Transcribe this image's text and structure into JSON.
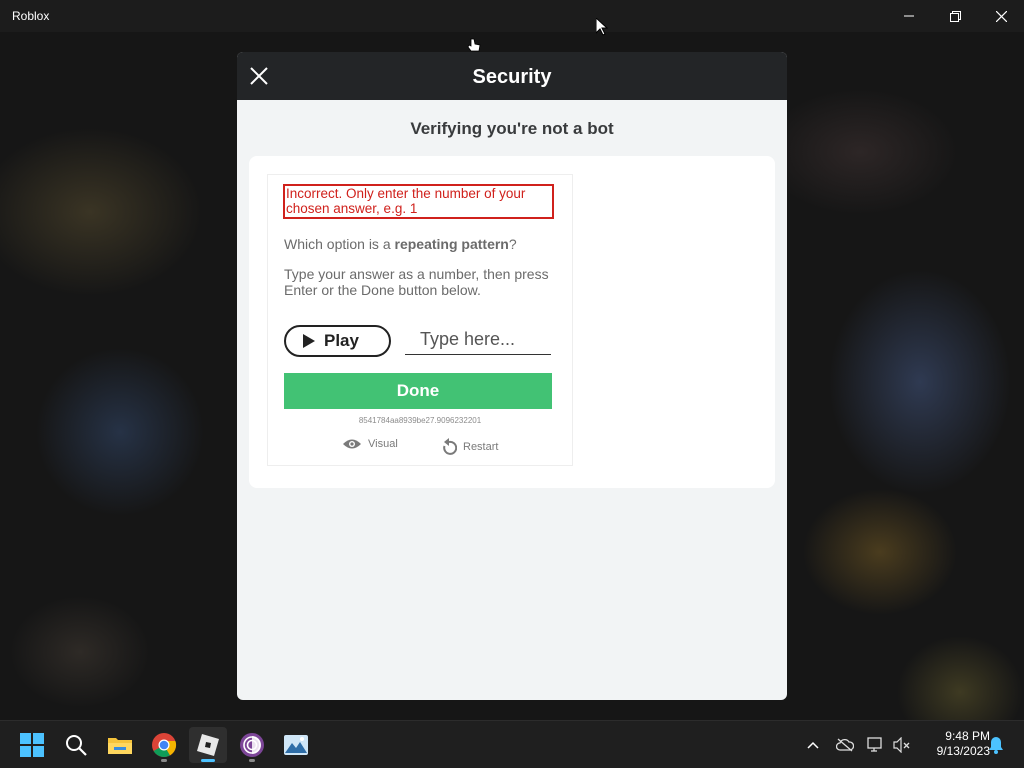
{
  "window": {
    "title": "Roblox"
  },
  "modal": {
    "title": "Security",
    "subtitle": "Verifying you're not a bot"
  },
  "challenge": {
    "error": "Incorrect. Only enter the number of your chosen answer, e.g. 1",
    "question_prefix": "Which option is a ",
    "question_bold": "repeating pattern",
    "question_suffix": "?",
    "instructions": "Type your answer as a number, then press Enter or the Done button below.",
    "play_label": "Play",
    "input_placeholder": "Type here...",
    "input_value": "",
    "done_label": "Done",
    "session_id": "8541784aa8939be27.9096232201",
    "visual_label": "Visual",
    "restart_label": "Restart",
    "accent_color": "#42c274",
    "error_color": "#d0211c"
  },
  "taskbar": {
    "icons": [
      "windows-start-icon",
      "search-icon",
      "file-explorer-icon",
      "chrome-icon",
      "roblox-icon",
      "tor-browser-icon",
      "photos-icon"
    ],
    "tray": [
      "chevron-up-icon",
      "onedrive-icon",
      "network-icon",
      "volume-muted-icon",
      "notification-bell-icon"
    ],
    "time": "9:48 PM",
    "date": "9/13/2023"
  }
}
